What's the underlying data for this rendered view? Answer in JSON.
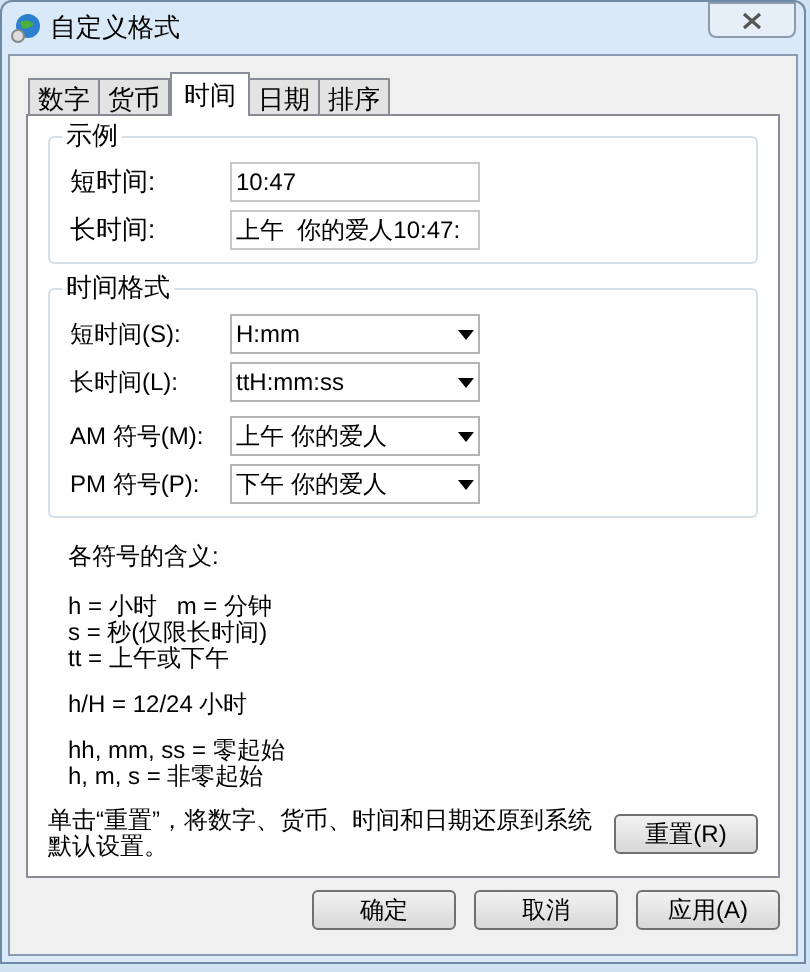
{
  "window": {
    "title": "自定义格式"
  },
  "tabs": [
    {
      "label": "数字",
      "selected": false
    },
    {
      "label": "货币",
      "selected": false
    },
    {
      "label": "时间",
      "selected": true
    },
    {
      "label": "日期",
      "selected": false
    },
    {
      "label": "排序",
      "selected": false
    }
  ],
  "example": {
    "title": "示例",
    "rows": [
      {
        "label": "短时间:",
        "value": "10:47"
      },
      {
        "label": "长时间:",
        "value": "上午  你的爱人10:47:"
      }
    ]
  },
  "format": {
    "title": "时间格式",
    "rows": [
      {
        "label": "短时间(S):",
        "value": "H:mm"
      },
      {
        "label": "长时间(L):",
        "value": "ttH:mm:ss"
      },
      {
        "label": "AM 符号(M):",
        "value": "上午 你的爱人"
      },
      {
        "label": "PM 符号(P):",
        "value": "下午 你的爱人"
      }
    ]
  },
  "legend": {
    "title": "各符号的含义:",
    "groups": [
      [
        "h = 小时   m = 分钟",
        "s = 秒(仅限长时间)",
        "tt = 上午或下午"
      ],
      [
        "h/H = 12/24 小时"
      ],
      [
        "hh, mm, ss = 零起始",
        "h, m, s = 非零起始"
      ]
    ]
  },
  "reset_note": "单击“重置”，将数字、货币、时间和日期还原到系统默认设置。",
  "reset_button": "重置(R)",
  "buttons": [
    "确定",
    "取消",
    "应用(A)"
  ]
}
